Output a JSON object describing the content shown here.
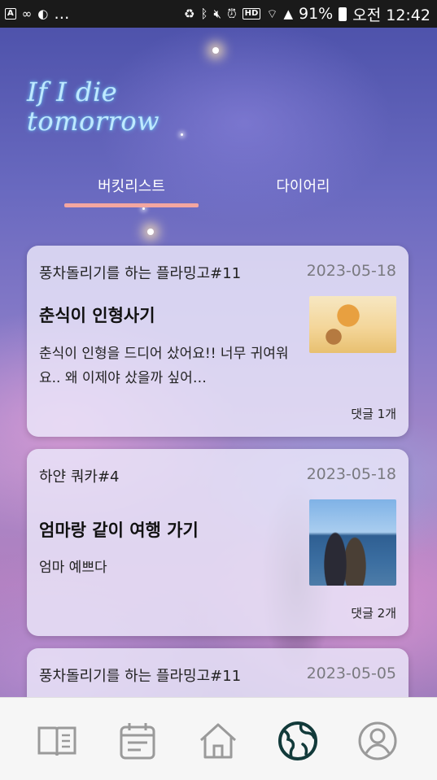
{
  "status_bar": {
    "left_text": "…",
    "battery": "91%",
    "time": "오전 12:42",
    "hd_label": "HD"
  },
  "app": {
    "title_line1": "If I die",
    "title_line2": "tomorrow"
  },
  "tabs": [
    {
      "label": "버킷리스트",
      "active": true
    },
    {
      "label": "다이어리",
      "active": false
    }
  ],
  "posts": [
    {
      "author": "풍차돌리기를 하는 플라밍고#11",
      "date": "2023-05-18",
      "title": "춘식이 인형사기",
      "body": "춘식이 인형을 드디어 샀어요!! 너무 귀여워요.. 왜 이제야 샀을까 싶어…",
      "comments": "댓글 1개"
    },
    {
      "author": "하얀 쿼카#4",
      "date": "2023-05-18",
      "title": "엄마랑 같이 여행 가기",
      "body": "엄마 예쁘다",
      "comments": "댓글 2개"
    },
    {
      "author": "풍차돌리기를 하는 플라밍고#11",
      "date": "2023-05-05"
    }
  ],
  "bottom_nav": [
    {
      "icon": "book-icon",
      "active": false
    },
    {
      "icon": "calendar-icon",
      "active": false
    },
    {
      "icon": "home-icon",
      "active": false
    },
    {
      "icon": "globe-icon",
      "active": true
    },
    {
      "icon": "profile-icon",
      "active": false
    }
  ],
  "colors": {
    "tab_underline": "#f4a6a0",
    "nav_active": "#123a3a",
    "nav_inactive": "#9a9a9a",
    "title_glow": "#bfe9ff"
  }
}
